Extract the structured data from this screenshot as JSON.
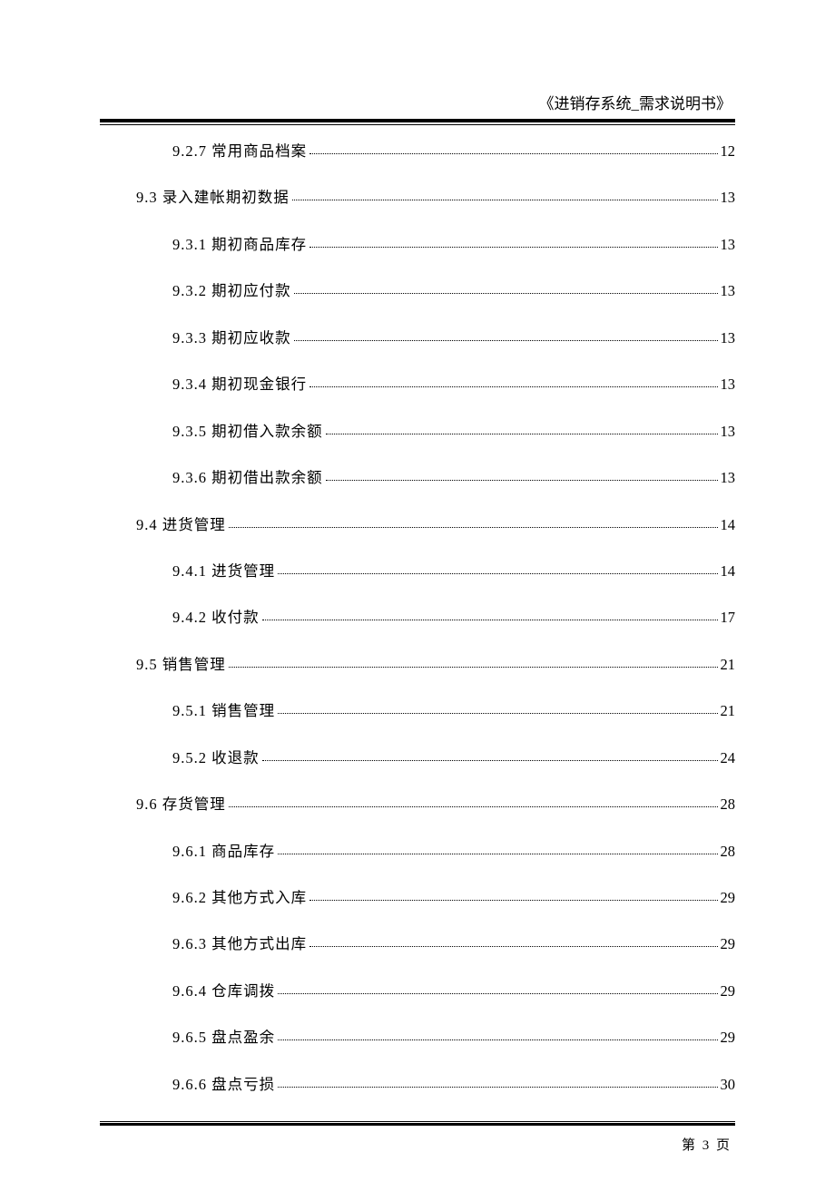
{
  "header": {
    "title": "《进销存系统_需求说明书》"
  },
  "toc": [
    {
      "level": 3,
      "label": "9.2.7 常用商品档案",
      "page": "12"
    },
    {
      "level": 2,
      "label": "9.3 录入建帐期初数据",
      "page": "13"
    },
    {
      "level": 3,
      "label": "9.3.1 期初商品库存",
      "page": "13"
    },
    {
      "level": 3,
      "label": "9.3.2 期初应付款",
      "page": "13"
    },
    {
      "level": 3,
      "label": "9.3.3 期初应收款",
      "page": "13"
    },
    {
      "level": 3,
      "label": "9.3.4 期初现金银行",
      "page": "13"
    },
    {
      "level": 3,
      "label": "9.3.5 期初借入款余额",
      "page": "13"
    },
    {
      "level": 3,
      "label": "9.3.6 期初借出款余额",
      "page": "13"
    },
    {
      "level": 2,
      "label": "9.4 进货管理",
      "page": "14"
    },
    {
      "level": 3,
      "label": "9.4.1 进货管理",
      "page": "14"
    },
    {
      "level": 3,
      "label": "9.4.2 收付款",
      "page": "17"
    },
    {
      "level": 2,
      "label": "9.5 销售管理",
      "page": "21"
    },
    {
      "level": 3,
      "label": "9.5.1 销售管理",
      "page": "21"
    },
    {
      "level": 3,
      "label": "9.5.2 收退款",
      "page": "24"
    },
    {
      "level": 2,
      "label": "9.6 存货管理",
      "page": "28"
    },
    {
      "level": 3,
      "label": "9.6.1 商品库存",
      "page": "28"
    },
    {
      "level": 3,
      "label": "9.6.2 其他方式入库",
      "page": "29"
    },
    {
      "level": 3,
      "label": "9.6.3 其他方式出库",
      "page": "29"
    },
    {
      "level": 3,
      "label": "9.6.4 仓库调拨",
      "page": "29"
    },
    {
      "level": 3,
      "label": "9.6.5 盘点盈余",
      "page": "29"
    },
    {
      "level": 3,
      "label": "9.6.6 盘点亏损",
      "page": "30"
    }
  ],
  "footer": {
    "text": "第 3 页"
  }
}
